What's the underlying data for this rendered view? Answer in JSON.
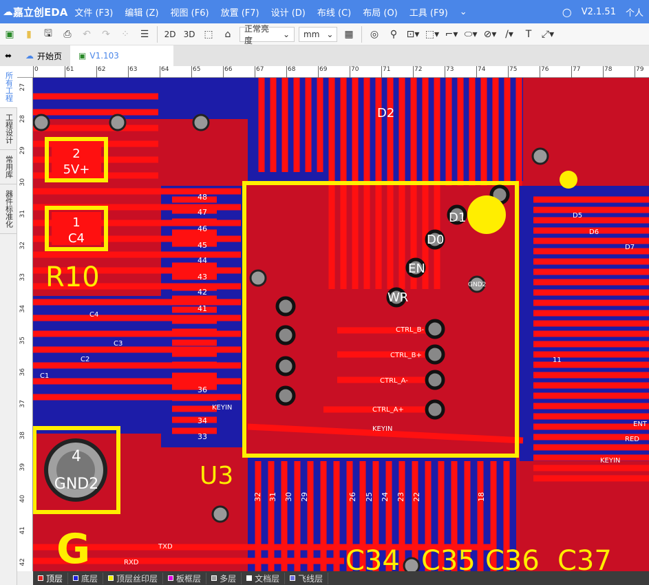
{
  "app": {
    "name": "嘉立创EDA",
    "version": "V2.1.51",
    "user": "个人"
  },
  "menu": [
    "文件 (F3)",
    "编辑 (Z)",
    "视图 (F6)",
    "放置 (F7)",
    "设计 (D)",
    "布线 (C)",
    "布局 (O)",
    "工具 (F9)"
  ],
  "toolbar": {
    "view2d": "2D",
    "view3d": "3D",
    "brightness": "正常亮度",
    "unit": "mm"
  },
  "tabs": [
    {
      "label": "开始页"
    },
    {
      "label": "V1.103"
    }
  ],
  "sidebar": [
    "所有工程",
    "工程设计",
    "常用库",
    "器件标准化"
  ],
  "ruler_top": [
    "0",
    "61",
    "62",
    "63",
    "64",
    "65",
    "66",
    "67",
    "68",
    "69",
    "70",
    "71",
    "72",
    "73",
    "74",
    "75",
    "76",
    "77",
    "78",
    "79"
  ],
  "ruler_left": [
    "27",
    "28",
    "29",
    "30",
    "31",
    "32",
    "33",
    "34",
    "35",
    "36",
    "37",
    "38",
    "39",
    "40",
    "41",
    "42"
  ],
  "pcb": {
    "components": [
      "R10",
      "U3",
      "G",
      "C34",
      "C35",
      "C36",
      "C37"
    ],
    "pads": {
      "p2": "2",
      "p2net": "5V+",
      "p1": "1",
      "p1net": "C4",
      "p4": "4",
      "p4net": "GND2"
    },
    "u3_pins_left": [
      "48",
      "47",
      "46",
      "45",
      "44",
      "43",
      "42",
      "41",
      "36",
      "34",
      "33"
    ],
    "u3_pins_bottom": [
      "32",
      "31",
      "30",
      "29",
      "26",
      "25",
      "24",
      "23",
      "22",
      "18"
    ],
    "nets": [
      "C4",
      "C3",
      "C2",
      "C1",
      "KEYIN",
      "TXD",
      "RXD",
      "CTRL_B-",
      "CTRL_B+",
      "CTRL_A-",
      "CTRL_A+",
      "EN",
      "WR",
      "D0",
      "D1",
      "D2",
      "GND2",
      "KEYIN"
    ],
    "right_labels": [
      "11",
      "D5",
      "D6",
      "D7",
      "ENT",
      "RED",
      "KEYIN"
    ]
  },
  "layers": [
    {
      "label": "顶层",
      "color": "#e02020"
    },
    {
      "label": "底层",
      "color": "#2020e0"
    },
    {
      "label": "顶层丝印层",
      "color": "#f0f000"
    },
    {
      "label": "板框层",
      "color": "#e000e0"
    },
    {
      "label": "多层",
      "color": "#a0a0a0"
    },
    {
      "label": "文档层",
      "color": "#ffffff"
    },
    {
      "label": "飞线层",
      "color": "#7070e0"
    }
  ]
}
